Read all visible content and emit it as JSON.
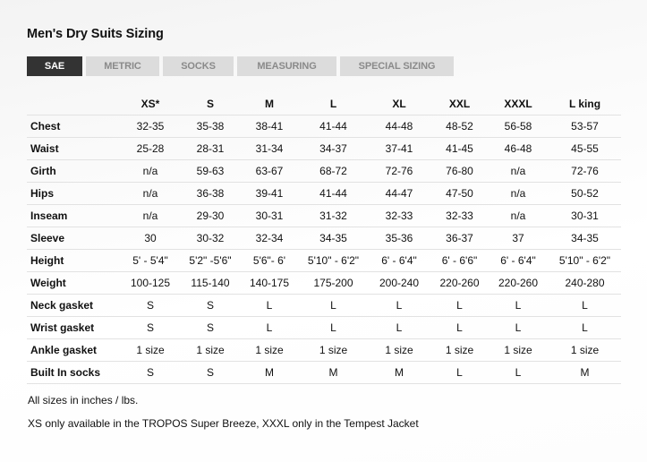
{
  "page": {
    "title": "Men's Dry Suits Sizing"
  },
  "tabs": [
    {
      "label": "SAE",
      "active": true
    },
    {
      "label": "METRIC",
      "active": false
    },
    {
      "label": "SOCKS",
      "active": false
    },
    {
      "label": "MEASURING",
      "active": false
    },
    {
      "label": "SPECIAL SIZING",
      "active": false
    }
  ],
  "table": {
    "columns": [
      "",
      "XS*",
      "S",
      "M",
      "L",
      "XL",
      "XXL",
      "XXXL",
      "L king"
    ],
    "rows": [
      {
        "label": "Chest",
        "values": [
          "32-35",
          "35-38",
          "38-41",
          "41-44",
          "44-48",
          "48-52",
          "56-58",
          "53-57"
        ]
      },
      {
        "label": "Waist",
        "values": [
          "25-28",
          "28-31",
          "31-34",
          "34-37",
          "37-41",
          "41-45",
          "46-48",
          "45-55"
        ]
      },
      {
        "label": "Girth",
        "values": [
          "n/a",
          "59-63",
          "63-67",
          "68-72",
          "72-76",
          "76-80",
          "n/a",
          "72-76"
        ]
      },
      {
        "label": "Hips",
        "values": [
          "n/a",
          "36-38",
          "39-41",
          "41-44",
          "44-47",
          "47-50",
          "n/a",
          "50-52"
        ]
      },
      {
        "label": "Inseam",
        "values": [
          "n/a",
          "29-30",
          "30-31",
          "31-32",
          "32-33",
          "32-33",
          "n/a",
          "30-31"
        ]
      },
      {
        "label": "Sleeve",
        "values": [
          "30",
          "30-32",
          "32-34",
          "34-35",
          "35-36",
          "36-37",
          "37",
          "34-35"
        ]
      },
      {
        "label": "Height",
        "values": [
          "5' - 5'4\"",
          "5'2\" -5'6\"",
          "5'6\"- 6'",
          "5'10\" - 6'2\"",
          "6' - 6'4\"",
          "6' - 6'6\"",
          "6' - 6'4\"",
          "5'10\" - 6'2\""
        ]
      },
      {
        "label": "Weight",
        "values": [
          "100-125",
          "115-140",
          "140-175",
          "175-200",
          "200-240",
          "220-260",
          "220-260",
          "240-280"
        ]
      },
      {
        "label": "Neck gasket",
        "values": [
          "S",
          "S",
          "L",
          "L",
          "L",
          "L",
          "L",
          "L"
        ]
      },
      {
        "label": "Wrist gasket",
        "values": [
          "S",
          "S",
          "L",
          "L",
          "L",
          "L",
          "L",
          "L"
        ]
      },
      {
        "label": "Ankle gasket",
        "values": [
          "1 size",
          "1 size",
          "1 size",
          "1 size",
          "1 size",
          "1 size",
          "1 size",
          "1 size"
        ]
      },
      {
        "label": "Built In socks",
        "values": [
          "S",
          "S",
          "M",
          "M",
          "M",
          "L",
          "L",
          "M"
        ]
      }
    ]
  },
  "notes": [
    "All sizes in inches / lbs.",
    "XS only available in the TROPOS Super Breeze, XXXL only in the Tempest Jacket"
  ],
  "colors": {
    "active_tab_bg": "#333333",
    "inactive_tab_bg": "#dcdcdc",
    "inactive_tab_text": "#8a8a8a",
    "row_divider": "#e2e2e2"
  }
}
